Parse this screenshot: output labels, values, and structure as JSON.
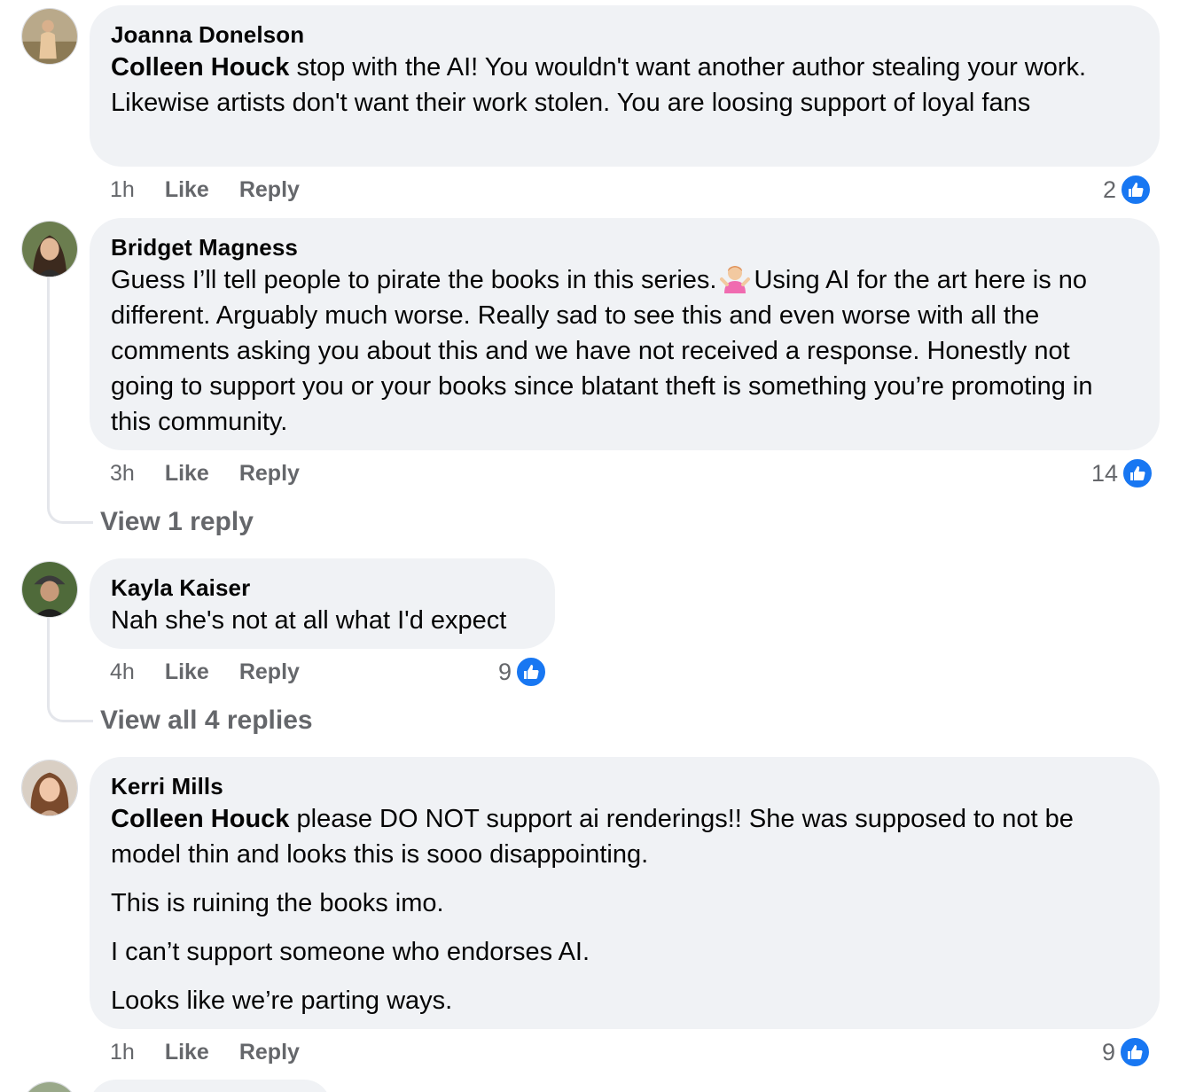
{
  "comments": [
    {
      "author": "Joanna Donelson",
      "tag": "Colleen Houck",
      "text": " stop with the AI! You wouldn't want another author stealing your work. Likewise artists don't want their work stolen. You are loosing support of loyal fans",
      "time": "1h",
      "like_label": "Like",
      "reply_label": "Reply",
      "reactions": "2"
    },
    {
      "author": "Bridget Magness",
      "text_a": "Guess I’ll tell people to pirate the books in this series.",
      "emoji": "person-shrugging-emoji",
      "text_b": "Using AI for the art here is no different. Arguably much worse. Really sad to see this and even worse with all the comments asking you about this and we have not received a response. Honestly not going to support you or your books since blatant theft is something you’re promoting in this community.",
      "time": "3h",
      "like_label": "Like",
      "reply_label": "Reply",
      "reactions": "14",
      "view_replies": "View 1 reply"
    },
    {
      "author": "Kayla Kaiser",
      "text": "Nah she's not at all what I'd expect",
      "time": "4h",
      "like_label": "Like",
      "reply_label": "Reply",
      "reactions": "9",
      "view_replies": "View all 4 replies"
    },
    {
      "author": "Kerri Mills",
      "tag": "Colleen Houck",
      "paragraphs": [
        " please DO NOT support ai renderings!! She was supposed to not be model thin and looks this is sooo disappointing.",
        "This is ruining the books imo.",
        "I can’t support someone who endorses AI.",
        "Looks like we’re parting ways."
      ],
      "time": "1h",
      "like_label": "Like",
      "reply_label": "Reply",
      "reactions": "9"
    }
  ],
  "icons": {
    "like": "thumbs-up-icon",
    "accent": "#1877f2"
  }
}
